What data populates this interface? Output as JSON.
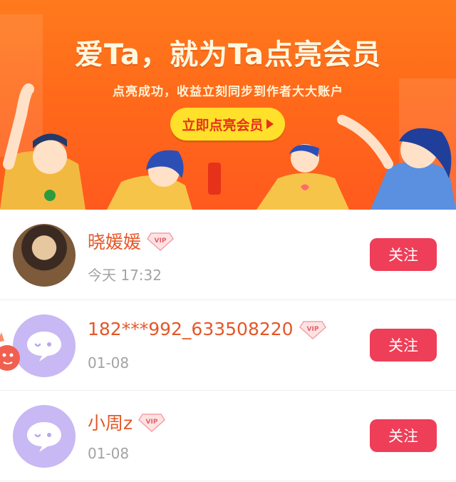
{
  "banner": {
    "title": "爱Ta，就为Ta点亮会员",
    "subtitle": "点亮成功，收益立刻同步到作者大大账户",
    "cta_label": "立即点亮会员"
  },
  "rows": [
    {
      "name": "晓媛媛",
      "time": "今天 17:32",
      "follow": "关注",
      "avatar": "photo"
    },
    {
      "name": "182***992_633508220",
      "time": "01-08",
      "follow": "关注",
      "avatar": "default-chat"
    },
    {
      "name": "小周z",
      "time": "01-08",
      "follow": "关注",
      "avatar": "default-chat"
    }
  ],
  "vip_badge": "VIP",
  "colors": {
    "banner": "#ff6a1a",
    "cta_bg": "#ffe02a",
    "name": "#e45728",
    "follow_btn": "#ee3e58",
    "avatar_default": "#c8b8f3"
  }
}
